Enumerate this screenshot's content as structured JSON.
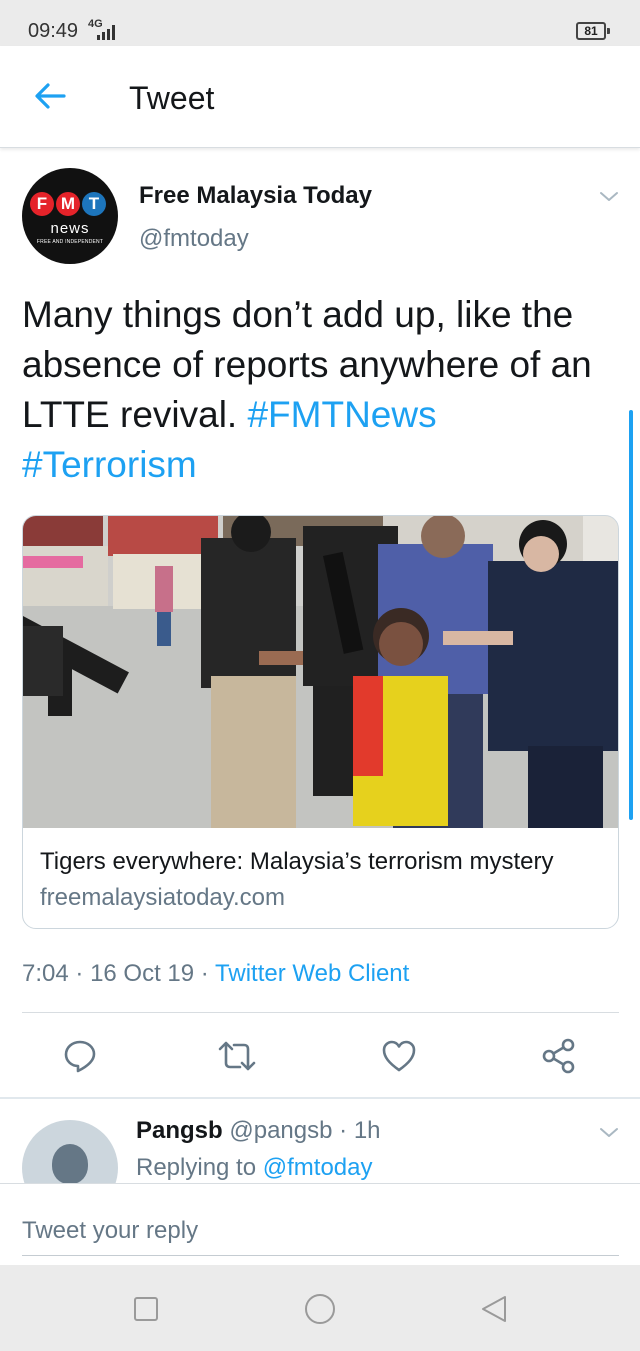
{
  "status_bar": {
    "time": "09:49",
    "network": "4G",
    "battery": "81"
  },
  "header": {
    "title": "Tweet",
    "back_icon": "arrow-left-icon"
  },
  "tweet": {
    "avatar": {
      "logo_letters": [
        "F",
        "M",
        "T"
      ],
      "logo_colors": [
        "#e5232a",
        "#e5232a",
        "#1d75bc"
      ],
      "word": "news",
      "tagline": "FREE AND INDEPENDENT"
    },
    "author_name": "Free Malaysia Today",
    "author_handle": "@fmtoday",
    "text_plain": "Many things don’t add up, like the absence of reports anywhere of an LTTE revival. ",
    "hashtag_1": "#FMTNews",
    "hashtag_2": "#Terrorism",
    "card": {
      "title": "Tigers everywhere: Malaysia’s terrorism mystery",
      "domain": "freemalaysiatoday.com"
    },
    "time": "7:04",
    "date": "16 Oct 19",
    "separator": "·",
    "client": "Twitter Web Client"
  },
  "actions": [
    {
      "name": "reply-icon"
    },
    {
      "name": "retweet-icon"
    },
    {
      "name": "like-icon"
    },
    {
      "name": "share-icon"
    }
  ],
  "reply": {
    "name": "Pangsb",
    "handle": "@pangsb",
    "time": "1h",
    "replying_label": "Replying to",
    "replying_to": "@fmtoday"
  },
  "compose": {
    "placeholder": "Tweet your reply"
  },
  "colors": {
    "accent": "#1da1f2",
    "secondary_text": "#657786",
    "primary_text": "#14171a"
  }
}
